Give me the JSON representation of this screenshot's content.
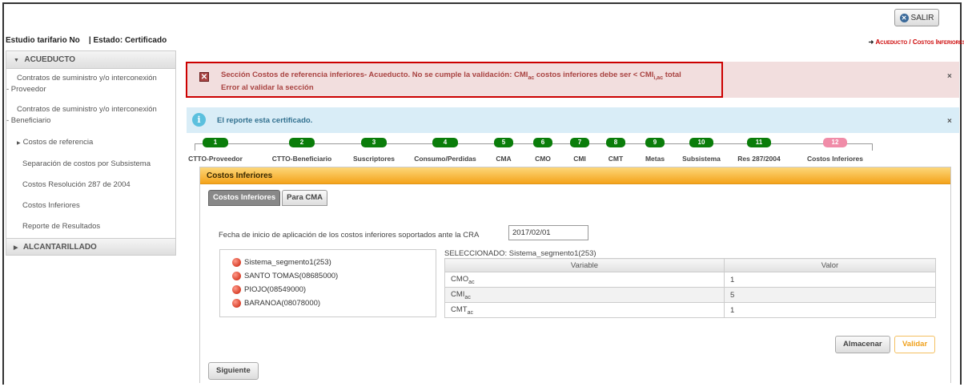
{
  "header": {
    "exit_label": "SALIR",
    "exit_icon": "close-circle-icon",
    "studio_label": "Estudio tarifario No",
    "status_label": "| Estado: Certificado",
    "breadcrumb": "Acueducto / Costos Inferiores"
  },
  "sidebar": {
    "sections": [
      {
        "label": "ACUEDUCTO"
      },
      {
        "label": "ALCANTARILLADO"
      }
    ],
    "items": [
      {
        "label": "Contratos de suministro y/o interconexión",
        "sub": "- Proveedor"
      },
      {
        "label": "Contratos de suministro y/o interconexión",
        "sub": "- Beneficiario"
      },
      {
        "label": "Costos de referencia"
      },
      {
        "label": "Separación de costos por Subsistema"
      },
      {
        "label": "Costos Resolución 287 de 2004"
      },
      {
        "label": "Costos Inferiores"
      },
      {
        "label": "Reporte de Resultados"
      }
    ]
  },
  "alerts": {
    "error_line1_pre": "Sección Costos de referencia inferiores- Acueducto. No se cumple la validación: CMI",
    "error_sub1": "ac",
    "error_line1_mid": " costos inferiores debe ser < CMI",
    "error_sub2": "i,ac",
    "error_line1_post": " total",
    "error_line2": "Error al validar la sección",
    "info": "El reporte esta certificado.",
    "close_glyph": "×"
  },
  "steps": [
    {
      "num": "1",
      "label": "CTTO-Proveedor"
    },
    {
      "num": "2",
      "label": "CTTO-Beneficiario"
    },
    {
      "num": "3",
      "label": "Suscriptores"
    },
    {
      "num": "4",
      "label": "Consumo/Perdidas"
    },
    {
      "num": "5",
      "label": "CMA"
    },
    {
      "num": "6",
      "label": "CMO"
    },
    {
      "num": "7",
      "label": "CMI"
    },
    {
      "num": "8",
      "label": "CMT"
    },
    {
      "num": "9",
      "label": "Metas"
    },
    {
      "num": "10",
      "label": "Subsistema"
    },
    {
      "num": "11",
      "label": "Res 287/2004"
    },
    {
      "num": "12",
      "label": "Costos Inferiores"
    }
  ],
  "panel": {
    "title": "Costos Inferiores",
    "tabs": [
      "Costos Inferiores",
      "Para CMA"
    ],
    "date_label": "Fecha de inicio de aplicación de los costos inferiores soportados ante la CRA",
    "date_value": "2017/02/01",
    "tree": [
      "Sistema_segmento1(253)",
      "SANTO TOMAS(08685000)",
      "PIOJO(08549000)",
      "BARANOA(08078000)"
    ],
    "selected_label": "SELECCIONADO: Sistema_segmento1(253)",
    "table": {
      "headers": [
        "Variable",
        "Valor"
      ],
      "rows": [
        {
          "var": "CMO",
          "sub": "ac",
          "val": "1"
        },
        {
          "var": "CMI",
          "sub": "ac",
          "val": "5"
        },
        {
          "var": "CMT",
          "sub": "ac",
          "val": "1"
        }
      ]
    },
    "buttons": {
      "store": "Almacenar",
      "validate": "Validar",
      "next": "Siguiente"
    }
  },
  "colors": {
    "error_bg": "#f2dede",
    "info_bg": "#d9edf7",
    "step_green": "#0a7d0a",
    "step_active": "#f08ca8",
    "panel_header": "#f4a31b"
  }
}
